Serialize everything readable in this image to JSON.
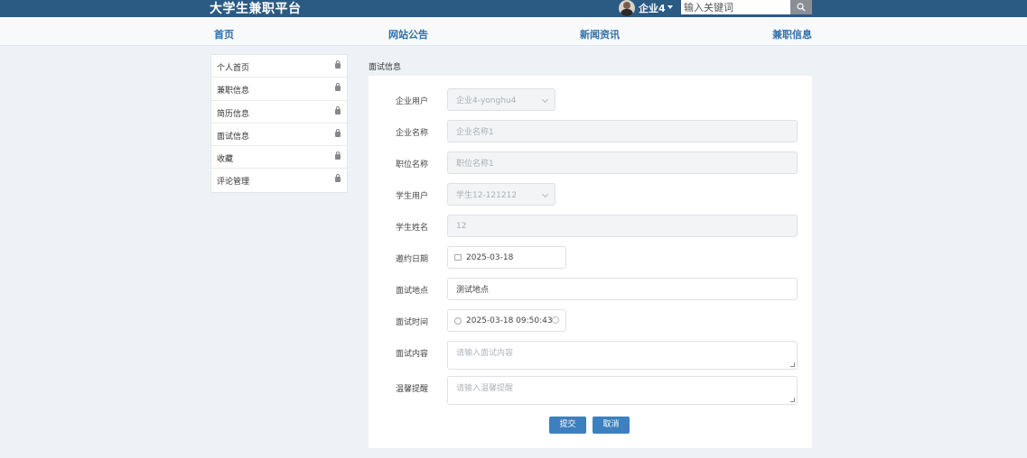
{
  "header": {
    "brand": "大学生兼职平台",
    "username": "企业4",
    "search_placeholder": "输入关键词"
  },
  "nav": {
    "items": [
      "首页",
      "网站公告",
      "新闻资讯",
      "兼职信息"
    ]
  },
  "sidebar": {
    "items": [
      "个人首页",
      "兼职信息",
      "简历信息",
      "面试信息",
      "收藏",
      "评论管理"
    ]
  },
  "section_title": "面试信息",
  "form": {
    "company_user_label": "企业用户",
    "company_user_value": "企业4-yonghu4",
    "company_name_label": "企业名称",
    "company_name_value": "企业名称1",
    "position_label": "职位名称",
    "position_value": "职位名称1",
    "student_user_label": "学生用户",
    "student_user_value": "学生12-121212",
    "student_name_label": "学生姓名",
    "student_name_value": "12",
    "invite_date_label": "邀约日期",
    "invite_date_value": "2025-03-18",
    "location_label": "面试地点",
    "location_value": "测试地点",
    "time_label": "面试时间",
    "time_value": "2025-03-18 09:50:43",
    "content_label": "面试内容",
    "content_placeholder": "请输入面试内容",
    "reminder_label": "温馨提醒",
    "reminder_placeholder": "请输入温馨提醒",
    "submit_label": "提交",
    "cancel_label": "取消"
  }
}
